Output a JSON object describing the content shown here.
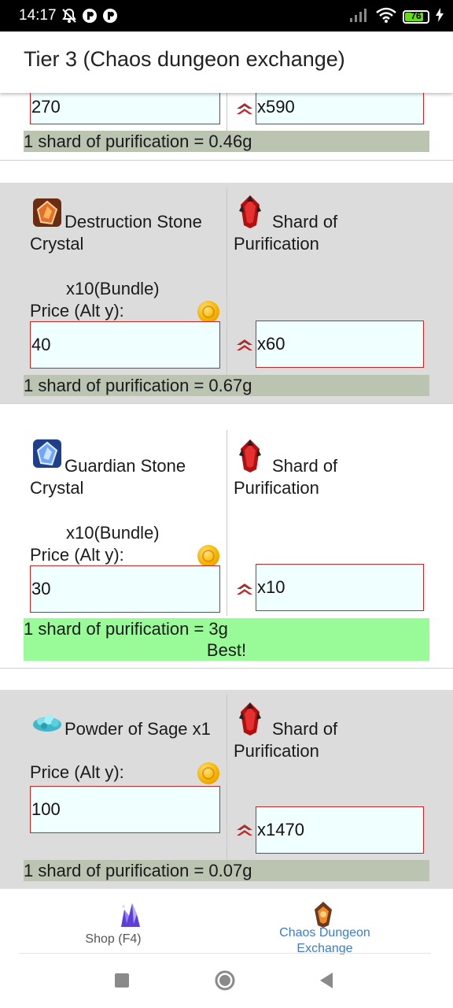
{
  "status_bar": {
    "time": "14:17",
    "battery": "76",
    "colors": {
      "background": "#000000",
      "battery_fill": "#64dd17"
    },
    "icons": [
      "notifications-off-icon",
      "app-notification-icon",
      "app-notification-icon",
      "signal-icon",
      "wifi-icon",
      "battery-icon",
      "charging-icon"
    ]
  },
  "app_bar": {
    "title": "Tier 3 (Chaos dungeon exchange)"
  },
  "rows": [
    {
      "price_value": "270",
      "shard_qty": "x590",
      "rate_text": "1 shard of purification = 0.46g"
    },
    {
      "item_name_line1": "Destruction Stone",
      "item_name_line2": "Crystal",
      "bundle": "x10(Bundle)",
      "price_label": "Price (Alt y):",
      "price_value": "40",
      "shard_name_line1": "Shard of",
      "shard_name_line2": "Purification",
      "shard_qty": "x60",
      "rate_text": "1 shard of purification = 0.67g"
    },
    {
      "item_name_line1": "Guardian Stone",
      "item_name_line2": "Crystal",
      "bundle": "x10(Bundle)",
      "price_label": "Price (Alt y):",
      "price_value": "30",
      "shard_name_line1": "Shard of",
      "shard_name_line2": "Purification",
      "shard_qty": "x10",
      "rate_text": "1 shard of purification = 3g",
      "best_text": "Best!"
    },
    {
      "item_name_line1": "Powder of Sage x1",
      "price_label": "Price (Alt y):",
      "price_value": "100",
      "shard_name_line1": "Shard of",
      "shard_name_line2": "Purification",
      "shard_qty": "x1470",
      "rate_text": "1 shard of purification = 0.07g"
    }
  ],
  "bottom_nav": {
    "items": [
      {
        "label": "Shop (F4)",
        "active": false
      },
      {
        "label_line1": "Chaos Dungeon",
        "label_line2": "Exchange",
        "active": true
      }
    ],
    "colors": {
      "active": "#3a7bd5",
      "inactive": "#555555"
    }
  },
  "colors": {
    "card_gray": "#dcdcdc",
    "input_bg": "#f0ffff",
    "input_border": "#c62828",
    "rate_bg": "#bac4b1",
    "best_bg": "#98fb98"
  }
}
